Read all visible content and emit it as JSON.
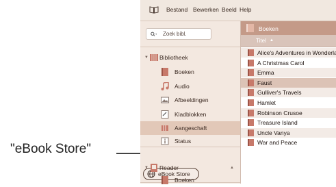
{
  "callout": {
    "text": "\"eBook Store\""
  },
  "menubar": {
    "items": [
      "Bestand",
      "Bewerken",
      "Beeld",
      "Help"
    ]
  },
  "sidebar": {
    "search_placeholder": "Zoek bibl.",
    "library": {
      "label": "Bibliotheek",
      "items": [
        {
          "label": "Boeken",
          "icon": "book-icon"
        },
        {
          "label": "Audio",
          "icon": "music-note-icon"
        },
        {
          "label": "Afbeeldingen",
          "icon": "image-icon"
        },
        {
          "label": "Kladblokken",
          "icon": "notebook-icon"
        },
        {
          "label": "Aangeschaft",
          "icon": "purchased-icon"
        },
        {
          "label": "Status",
          "icon": "info-icon"
        }
      ]
    },
    "store": {
      "label": "eBook Store",
      "icon": "globe-icon"
    },
    "reader": {
      "label": "Reader",
      "items": [
        {
          "label": "Boeken",
          "icon": "book-icon"
        }
      ]
    }
  },
  "main": {
    "header": "Boeken",
    "column": "Titel",
    "books": [
      "Alice's Adventures in Wonderland",
      "A Christmas Carol",
      "Emma",
      "Faust",
      "Gulliver's Travels",
      "Hamlet",
      "Robinson Crusoe",
      "Treasure Island",
      "Uncle Vanya",
      "War and Peace"
    ]
  },
  "colors": {
    "accent": "#c49a88",
    "selection": "#e2c8b8",
    "book_icon": "#c7796a"
  }
}
